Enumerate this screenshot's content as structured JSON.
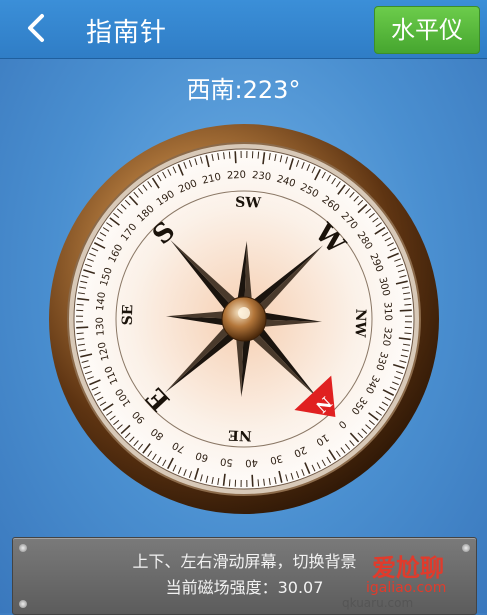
{
  "header": {
    "back_icon": "chevron-left-icon",
    "title": "指南针",
    "level_button": "水平仪"
  },
  "compass": {
    "heading_text": "西南:223°",
    "heading_degrees": 223,
    "dial_labels": [
      "0",
      "10",
      "20",
      "30",
      "40",
      "50",
      "60",
      "70",
      "80",
      "90",
      "100",
      "110",
      "120",
      "130",
      "140",
      "150",
      "160",
      "170",
      "180",
      "190",
      "200",
      "210",
      "220",
      "230",
      "240",
      "250",
      "260",
      "270",
      "280",
      "290",
      "300",
      "310",
      "320",
      "330",
      "340",
      "350"
    ],
    "direction_labels": {
      "N": "N",
      "NE": "NE",
      "E": "E",
      "SE": "SE",
      "S": "S",
      "SW": "SW",
      "W": "W",
      "NW": "NW"
    }
  },
  "footer": {
    "hint": "上下、左右滑动屏幕，切换背景",
    "strength": "当前磁场强度：30.07"
  },
  "watermark": {
    "brand": "爱尬聊",
    "url": "igaliao.com",
    "sub": "qkuaru.com"
  },
  "colors": {
    "header": "#2f7dc6",
    "level_button": "#46a62f",
    "background": "#4a8fd0",
    "bezel": "#6b3f1a",
    "north_marker": "#e02020"
  }
}
